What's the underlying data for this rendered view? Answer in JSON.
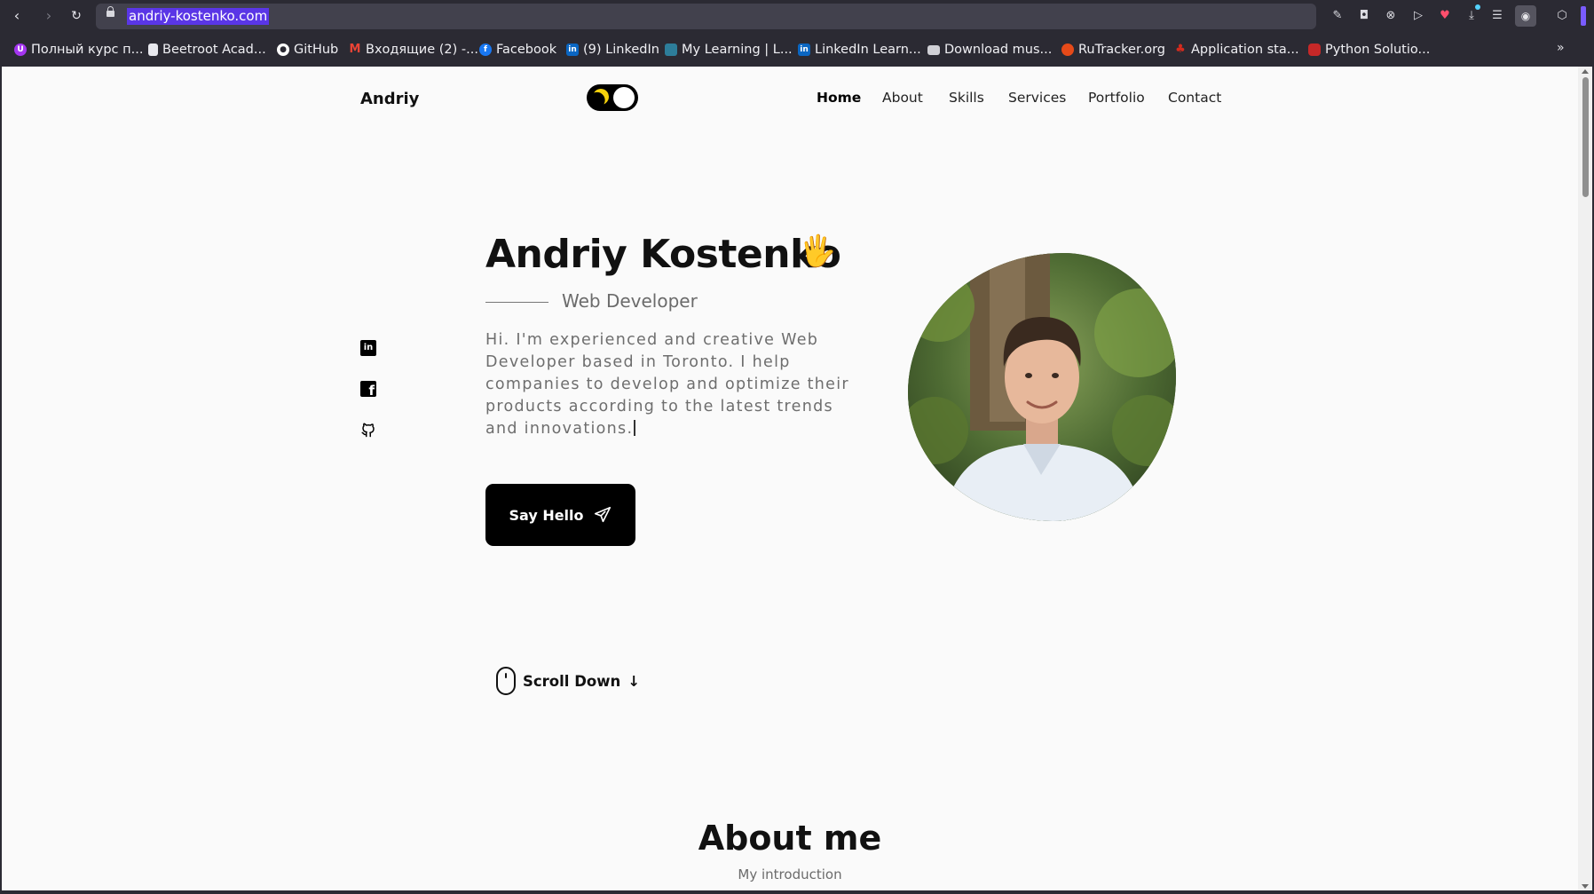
{
  "browser": {
    "url": "andriy-kostenko.com",
    "bookmarks": [
      {
        "label": "Полный курс п...",
        "icon": "udemy-icon",
        "color": "#a435f0"
      },
      {
        "label": "Beetroot Acad...",
        "icon": "page-icon",
        "color": "#e8e8ee"
      },
      {
        "label": "GitHub",
        "icon": "github-icon",
        "color": "#ffffff"
      },
      {
        "label": "Входящие (2) -...",
        "icon": "gmail-icon",
        "color": "#ea4335"
      },
      {
        "label": "Facebook",
        "icon": "facebook-icon",
        "color": "#1877f2"
      },
      {
        "label": "(9) LinkedIn",
        "icon": "linkedin-icon",
        "color": "#0a66c2"
      },
      {
        "label": "My Learning | L...",
        "icon": "learning-icon",
        "color": "#2d7d9a"
      },
      {
        "label": "LinkedIn Learn...",
        "icon": "linkedin-icon",
        "color": "#0a66c2"
      },
      {
        "label": "Download mus...",
        "icon": "monitor-icon",
        "color": "#d0d0d6"
      },
      {
        "label": "RuTracker.org",
        "icon": "rutracker-icon",
        "color": "#e64a19"
      },
      {
        "label": "Application sta...",
        "icon": "maple-leaf-icon",
        "color": "#d52b1e"
      },
      {
        "label": "Python Solutio...",
        "icon": "python-solutions-icon",
        "color": "#c62828"
      }
    ]
  },
  "site": {
    "logo": "Andriy",
    "nav": [
      "Home",
      "About",
      "Skills",
      "Services",
      "Portfolio",
      "Contact"
    ],
    "active_nav": "Home",
    "hero": {
      "name": "Andriy Kostenko",
      "wave_emoji": "🖐",
      "subtitle": "Web Developer",
      "description": "Hi. I'm experienced and creative Web Developer based in Toronto. I help companies to develop and optimize their products according to the latest trends and innovations.",
      "cta": "Say Hello"
    },
    "social": [
      "linkedin-icon",
      "facebook-icon",
      "github-icon"
    ],
    "scroll_down": "Scroll Down",
    "about": {
      "title": "About me",
      "subtitle": "My introduction"
    }
  },
  "colors": {
    "accent": "#000000",
    "toggle_moon": "#f6d20b",
    "url_highlight": "#5a36e6",
    "page_bg": "#fafafa"
  }
}
